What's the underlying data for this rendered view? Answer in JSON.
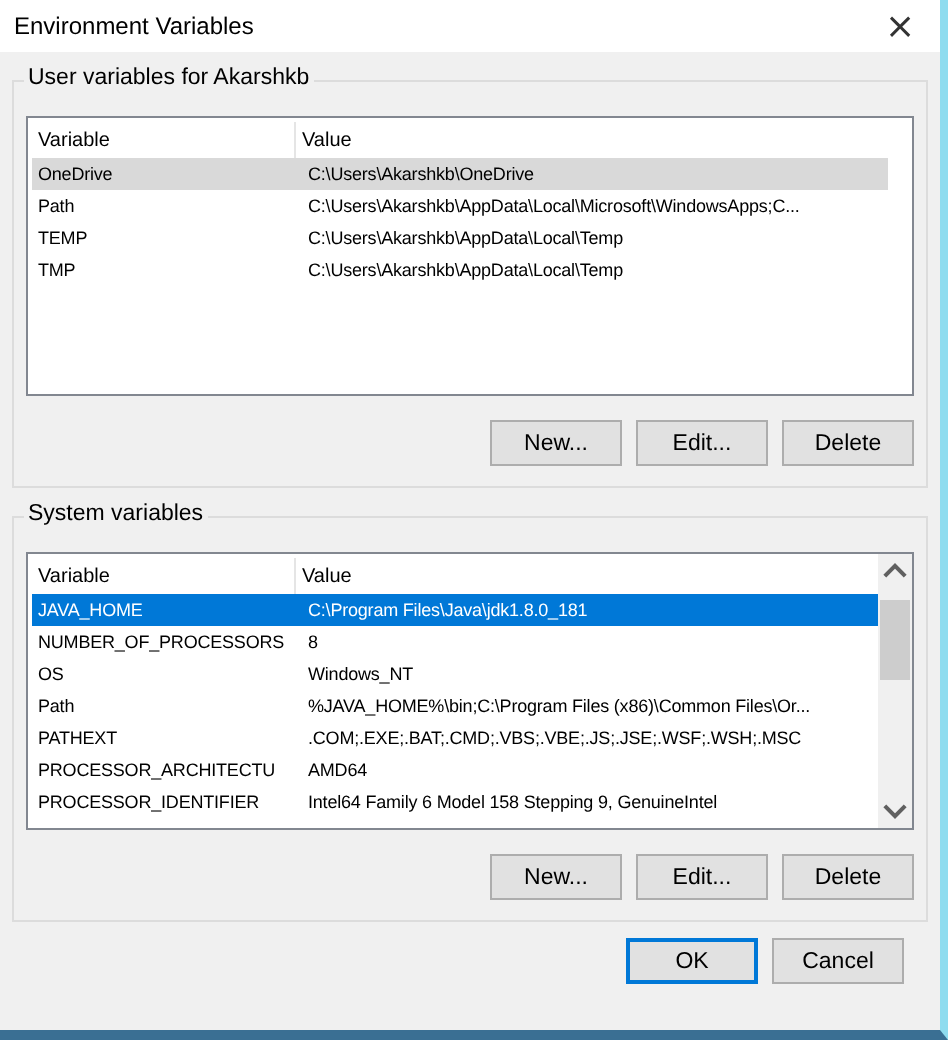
{
  "window": {
    "title": "Environment Variables",
    "close": "×"
  },
  "user_group": {
    "title": "User variables for Akarshkb",
    "columns": [
      "Variable",
      "Value"
    ],
    "rows": [
      {
        "variable": "OneDrive",
        "value": "C:\\Users\\Akarshkb\\OneDrive",
        "selected": true
      },
      {
        "variable": "Path",
        "value": "C:\\Users\\Akarshkb\\AppData\\Local\\Microsoft\\WindowsApps;C...",
        "selected": false
      },
      {
        "variable": "TEMP",
        "value": "C:\\Users\\Akarshkb\\AppData\\Local\\Temp",
        "selected": false
      },
      {
        "variable": "TMP",
        "value": "C:\\Users\\Akarshkb\\AppData\\Local\\Temp",
        "selected": false
      }
    ],
    "buttons": [
      "New...",
      "Edit...",
      "Delete"
    ]
  },
  "system_group": {
    "title": "System variables",
    "columns": [
      "Variable",
      "Value"
    ],
    "rows": [
      {
        "variable": "JAVA_HOME",
        "value": "C:\\Program Files\\Java\\jdk1.8.0_181",
        "selected": true
      },
      {
        "variable": "NUMBER_OF_PROCESSORS",
        "value": "8",
        "selected": false
      },
      {
        "variable": "OS",
        "value": "Windows_NT",
        "selected": false
      },
      {
        "variable": "Path",
        "value": "%JAVA_HOME%\\bin;C:\\Program Files (x86)\\Common Files\\Or...",
        "selected": false
      },
      {
        "variable": "PATHEXT",
        "value": ".COM;.EXE;.BAT;.CMD;.VBS;.VBE;.JS;.JSE;.WSF;.WSH;.MSC",
        "selected": false
      },
      {
        "variable": "PROCESSOR_ARCHITECTU",
        "value": "AMD64",
        "selected": false
      },
      {
        "variable": "PROCESSOR_IDENTIFIER",
        "value": "Intel64 Family 6 Model 158 Stepping 9, GenuineIntel",
        "selected": false
      }
    ],
    "buttons": [
      "New...",
      "Edit...",
      "Delete"
    ]
  },
  "dialog_buttons": [
    {
      "label": "OK",
      "default": true
    },
    {
      "label": "Cancel",
      "default": false
    }
  ]
}
